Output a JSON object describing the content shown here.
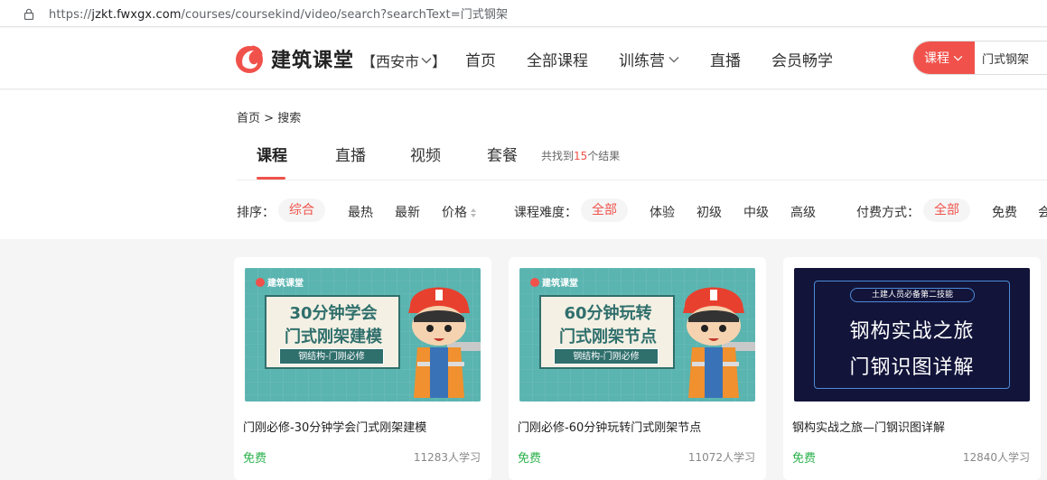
{
  "browser": {
    "url_scheme": "https://",
    "url_host": "jzkt.fwxgx.com",
    "url_path": "/courses/coursekind/video/search?searchText=门式钢架"
  },
  "header": {
    "logo_text": "建筑课堂",
    "city": "【西安市",
    "city_suffix": "】",
    "nav": [
      "首页",
      "全部课程",
      "训练营",
      "直播",
      "会员畅学"
    ],
    "search_type": "课程",
    "search_value": "门式钢架"
  },
  "breadcrumb": {
    "home": "首页",
    "sep": ">",
    "current": "搜索"
  },
  "tabs": [
    "课程",
    "直播",
    "视频",
    "套餐"
  ],
  "result": {
    "prefix": "共找到",
    "count": "15",
    "suffix": "个结果"
  },
  "filters": {
    "sort_label": "排序：",
    "sort_options": [
      "综合",
      "最热",
      "最新",
      "价格"
    ],
    "level_label": "课程难度：",
    "level_options": [
      "全部",
      "体验",
      "初级",
      "中级",
      "高级"
    ],
    "pay_label": "付费方式：",
    "pay_options": [
      "全部",
      "免费",
      "会"
    ]
  },
  "cards": [
    {
      "title": "门刚必修-30分钟学会门式刚架建模",
      "price": "免费",
      "learners": "11283人学习",
      "thumb_brand": "建筑课堂",
      "thumb_line1": "30分钟学会",
      "thumb_line2": "门式刚架建模",
      "thumb_tag": "钢结构-门刚必修",
      "thumb_color": "#5ab4b0"
    },
    {
      "title": "门刚必修-60分钟玩转门式刚架节点",
      "price": "免费",
      "learners": "11072人学习",
      "thumb_brand": "建筑课堂",
      "thumb_line1": "60分钟玩转",
      "thumb_line2": "门式刚架节点",
      "thumb_tag": "钢结构-门刚必修",
      "thumb_color": "#5ab4b0"
    },
    {
      "title": "钢构实战之旅—门钢识图详解",
      "price": "免费",
      "learners": "12840人学习",
      "thumb_pill": "土建人员必备第二技能",
      "thumb_line1": "钢构实战之旅",
      "thumb_line2": "门钢识图详解",
      "thumb_color": "#12143a"
    }
  ],
  "colors": {
    "accent": "#f0524b",
    "free": "#2bb24c"
  }
}
